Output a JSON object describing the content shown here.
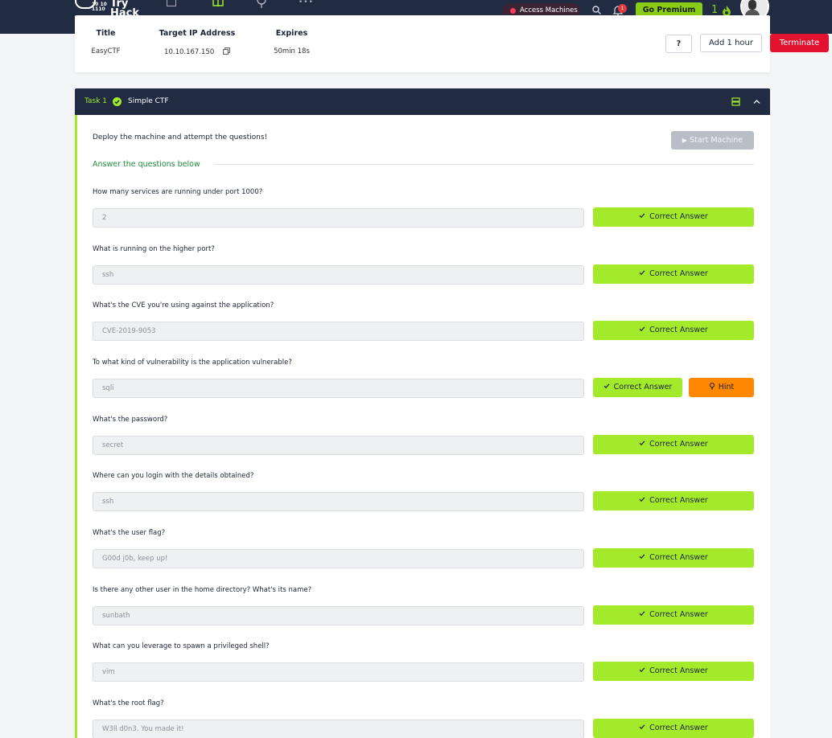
{
  "topnav": {
    "brand": "Try Hack",
    "brand_nums": "10 10\n1110",
    "access_label": "Access Machines",
    "notif_count": "1",
    "premium_label": "Go Premium",
    "streak": "1",
    "colors": {
      "bg": "#212c42",
      "accent": "#88cc14",
      "alert": "#ff3a55"
    },
    "icons": [
      "tryhackme-logo-icon",
      "document-icon",
      "book-icon",
      "podcast-icon",
      "more-dots-icon",
      "search-icon",
      "bell-icon",
      "fire-icon",
      "avatar"
    ]
  },
  "machine": {
    "title_head": "Title",
    "title_val": "EasyCTF",
    "ip_head": "Target IP Address",
    "ip_val": "10.10.167.150",
    "expires_head": "Expires",
    "expires_val": "50min 18s",
    "help_label": "?",
    "add_label": "Add 1 hour",
    "terminate_label": "Terminate",
    "terminate_color": "#e3122f"
  },
  "task": {
    "label": "Task 1",
    "title": "Simple CTF",
    "intro": "Deploy the machine and attempt the questions!",
    "start_label": "Start Machine",
    "answers_head": "Answer the questions below",
    "correct_label": "Correct Answer",
    "hint_label": "Hint",
    "colors": {
      "correct": "#a3ea2a",
      "hint": "#ff8800"
    },
    "questions": [
      {
        "q": "How many services are running under port 1000?",
        "a": "2"
      },
      {
        "q": "What is running on the higher port?",
        "a": "ssh"
      },
      {
        "q": "What's the CVE you're using against the application?",
        "a": "CVE-2019-9053"
      },
      {
        "q": "To what kind of vulnerability is the application vulnerable?",
        "a": "sqli"
      },
      {
        "q": "What's the password?",
        "a": "secret"
      },
      {
        "q": "Where can you login with the details obtained?",
        "a": "ssh"
      },
      {
        "q": "What's the user flag?",
        "a": "G00d j0b, keep up!"
      },
      {
        "q": "Is there any other user in the home directory? What's its name?",
        "a": "sunbath"
      },
      {
        "q": "What can you leverage to spawn a privileged shell?",
        "a": "vim"
      },
      {
        "q": "What's the root flag?",
        "a": "W3ll d0n3. You made it!"
      }
    ]
  }
}
